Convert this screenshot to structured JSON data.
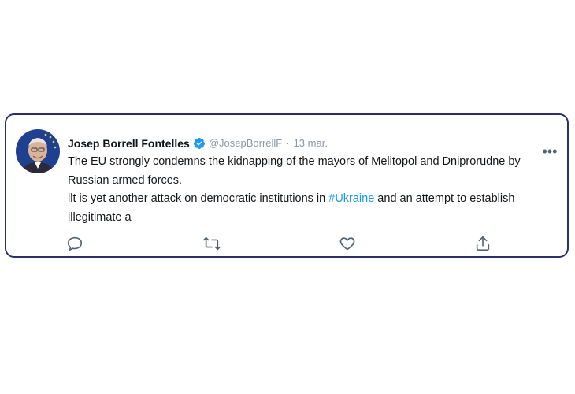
{
  "tweet": {
    "author_name": "Josep Borrell Fontelles",
    "handle": "@JosepBorrellF",
    "separator": "·",
    "date": "13 mar.",
    "text_line1": "The EU strongly condemns the kidnapping of the mayors of Melitopol and Dniprorudne by Russian armed forces.",
    "text_line2_before": "llt is yet another attack on democratic institutions in ",
    "hashtag": "#Ukraine",
    "text_line2_after": " and an attempt to establish illegitimate a",
    "more_label": "•••"
  },
  "icons": {
    "verified": "verified-badge-icon",
    "reply": "reply-icon",
    "retweet": "retweet-icon",
    "like": "heart-icon",
    "share": "share-icon",
    "more": "more-options-icon"
  },
  "colors": {
    "card_border": "#2b2f6b",
    "hashtag": "#1d9bf0",
    "verified": "#1d9bf0",
    "muted": "#8b98a5"
  }
}
